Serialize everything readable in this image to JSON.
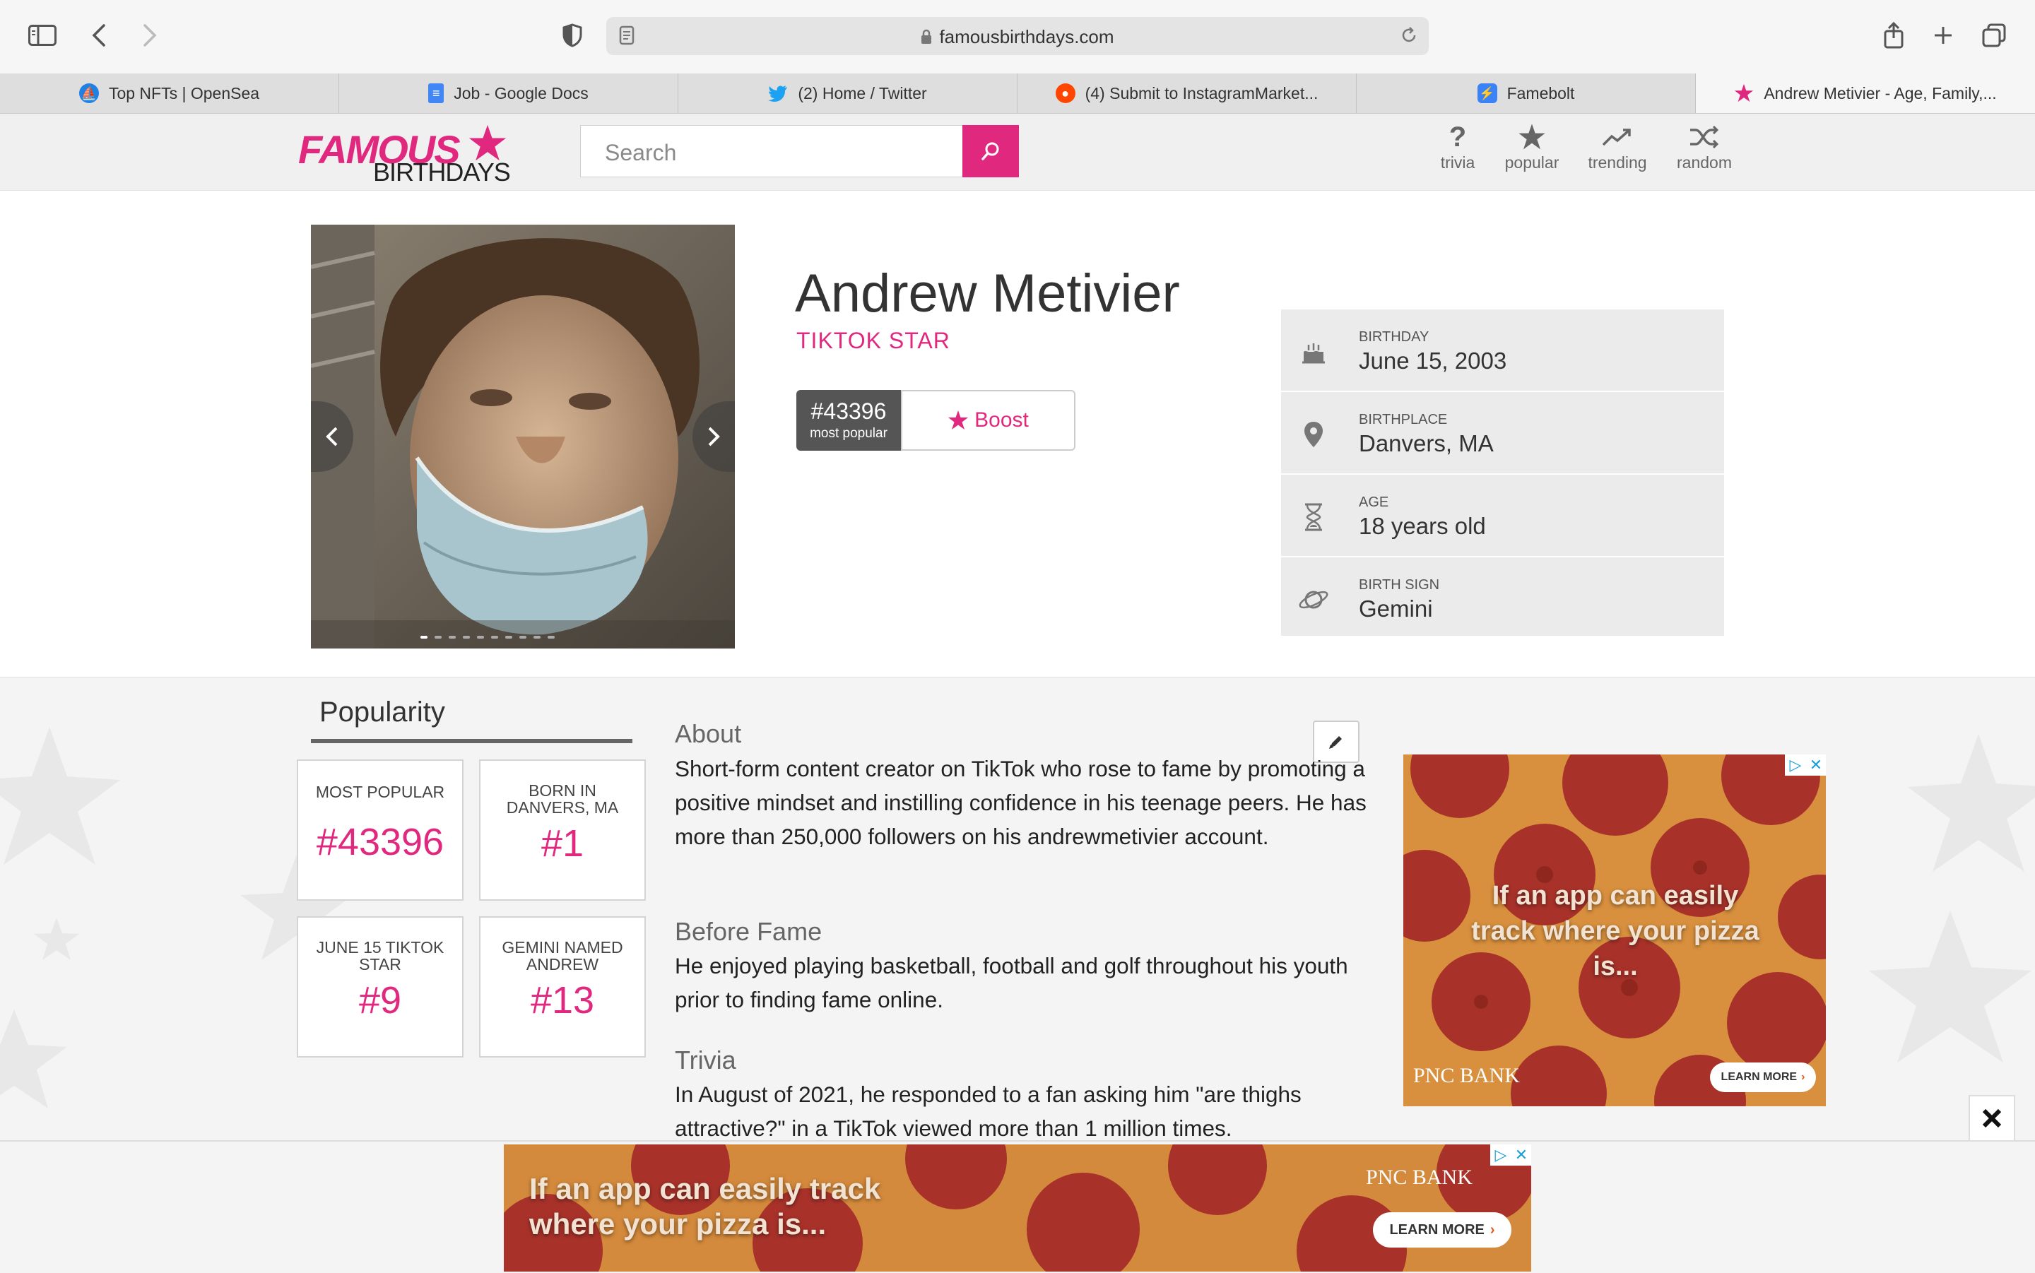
{
  "browser": {
    "url": "famousbirthdays.com",
    "tabs": [
      {
        "label": "Top NFTs | OpenSea",
        "color": "#2081e2"
      },
      {
        "label": "Job - Google Docs",
        "color": "#4285f4"
      },
      {
        "label": "(2) Home / Twitter",
        "color": "#1da1f2"
      },
      {
        "label": "(4) Submit to InstagramMarket...",
        "color": "#ff4500"
      },
      {
        "label": "Famebolt",
        "color": "#3b82f6"
      },
      {
        "label": "Andrew Metivier - Age, Family,...",
        "color": "#e0287f"
      }
    ]
  },
  "site": {
    "logo_top": "FAMOUS",
    "logo_bottom": "BIRTHDAYS",
    "search_placeholder": "Search",
    "nav": [
      {
        "label": "trivia",
        "icon": "question-icon"
      },
      {
        "label": "popular",
        "icon": "star-icon"
      },
      {
        "label": "trending",
        "icon": "trending-icon"
      },
      {
        "label": "random",
        "icon": "shuffle-icon"
      }
    ]
  },
  "profile": {
    "name": "Andrew Metivier",
    "occupation": "TIKTOK STAR",
    "rank": "#43396",
    "rank_caption": "most popular",
    "boost_label": "Boost",
    "info": [
      {
        "label": "BIRTHDAY",
        "value": "June 15, 2003",
        "icon": "cake-icon"
      },
      {
        "label": "BIRTHPLACE",
        "value": "Danvers, MA",
        "icon": "location-pin-icon"
      },
      {
        "label": "AGE",
        "value": "18 years old",
        "icon": "hourglass-icon"
      },
      {
        "label": "BIRTH SIGN",
        "value": "Gemini",
        "icon": "planet-icon"
      }
    ]
  },
  "popularity": {
    "title": "Popularity",
    "cards": [
      {
        "title": "MOST POPULAR",
        "value": "#43396"
      },
      {
        "title": "BORN IN DANVERS, MA",
        "value": "#1"
      },
      {
        "title": "JUNE 15 TIKTOK STAR",
        "value": "#9"
      },
      {
        "title": "GEMINI NAMED ANDREW",
        "value": "#13"
      }
    ]
  },
  "bio": {
    "about_title": "About",
    "about_text": "Short-form content creator on TikTok who rose to fame by promoting a positive mindset and instilling confidence in his teenage peers. He has more than 250,000 followers on his andrewmetivier account.",
    "before_title": "Before Fame",
    "before_text": "He enjoyed playing basketball, football and golf throughout his youth prior to finding fame online.",
    "trivia_title": "Trivia",
    "trivia_text": "In August of 2021, he responded to a fan asking him \"are thighs attractive?\" in a TikTok viewed more than 1 million times."
  },
  "ads": {
    "side_headline": "If an app can easily track where your pizza is...",
    "bottom_headline": "If an app can easily track where your pizza is...",
    "brand": "PNC BANK",
    "cta": "LEARN MORE"
  },
  "colors": {
    "brand": "#e0287f",
    "panel": "#ebebeb"
  }
}
